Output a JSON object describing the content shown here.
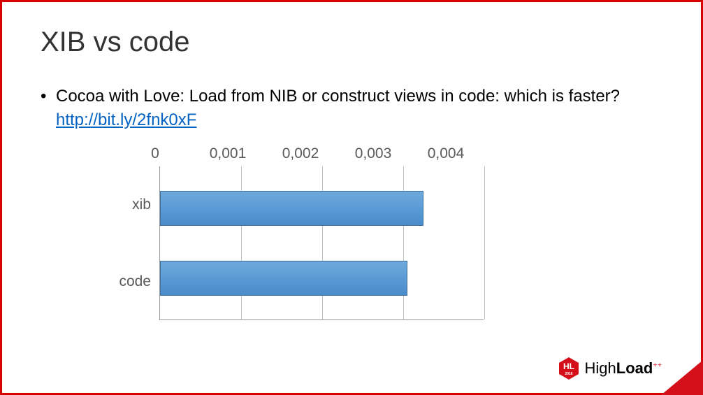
{
  "title": "XIB vs code",
  "bullet": {
    "text_before": "Cocoa with Love: Load from NIB or construct views in code: which is faster? ",
    "link_text": "http://bit.ly/2fnk0xF"
  },
  "chart_data": {
    "type": "bar",
    "orientation": "horizontal",
    "categories": [
      "xib",
      "code"
    ],
    "values": [
      0.00325,
      0.00305
    ],
    "xlim": [
      0,
      0.004
    ],
    "ticks": [
      "0",
      "0,001",
      "0,002",
      "0,003",
      "0,004"
    ],
    "title": "",
    "xlabel": "",
    "ylabel": ""
  },
  "footer": {
    "brand_pre": "High",
    "brand_bold": "Load",
    "plus": "++",
    "badge_top": "HL",
    "badge_year": "2016"
  }
}
